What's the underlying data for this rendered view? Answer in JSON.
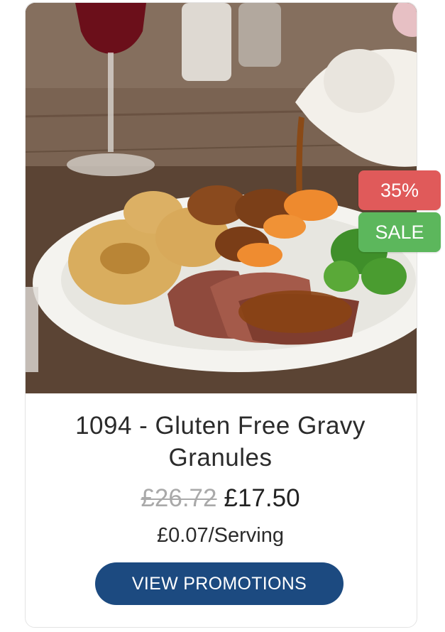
{
  "product": {
    "title": "1094 - Gluten Free Gravy Granules",
    "price_old": "£26.72",
    "price_new": "£17.50",
    "per_serving": "£0.07/Serving",
    "image_subject": "roast dinner plate with gravy being poured"
  },
  "badges": {
    "discount": "35%",
    "sale": "SALE"
  },
  "actions": {
    "view_promotions": "VIEW PROMOTIONS"
  },
  "colors": {
    "discount_badge": "#e05a5a",
    "sale_badge": "#5cb75c",
    "button": "#1c4a80",
    "old_price": "#a9a9a9"
  }
}
